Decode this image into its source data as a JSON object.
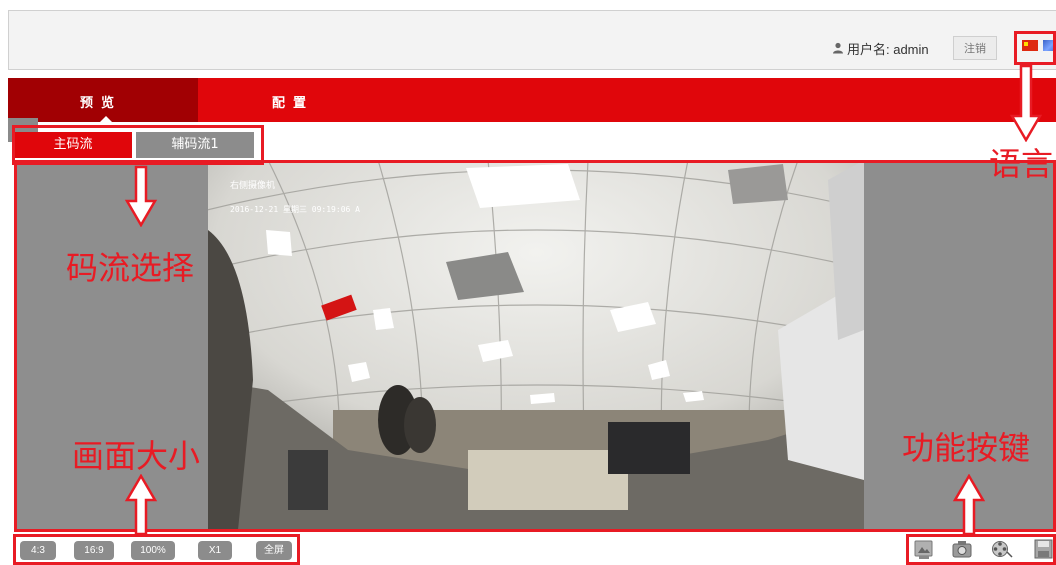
{
  "header": {
    "username_label": "用户名: admin",
    "logout_label": "注销"
  },
  "nav": {
    "tabs": [
      {
        "label": "预览",
        "active": true
      },
      {
        "label": "配置",
        "active": false
      }
    ]
  },
  "streams": {
    "tabs": [
      {
        "label": "主码流",
        "active": true
      },
      {
        "label": "辅码流1",
        "active": false
      }
    ]
  },
  "video": {
    "osd_title": "右侧摄像机",
    "osd_datetime": "2016-12-21 星期三 09:19:06 A"
  },
  "size_buttons": [
    "4:3",
    "16:9",
    "100%",
    "X1",
    "全屏"
  ],
  "function_buttons": [
    "capture-icon",
    "snapshot-icon",
    "record-icon",
    "save-icon"
  ],
  "annotations": {
    "language": "语言",
    "stream_select": "码流选择",
    "picture_size": "画面大小",
    "function_keys": "功能按键"
  },
  "colors": {
    "nav_red": "#e0060b",
    "nav_active": "#a10003",
    "annotation_red": "#e81b24",
    "panel_gray": "#8e8e8e"
  }
}
